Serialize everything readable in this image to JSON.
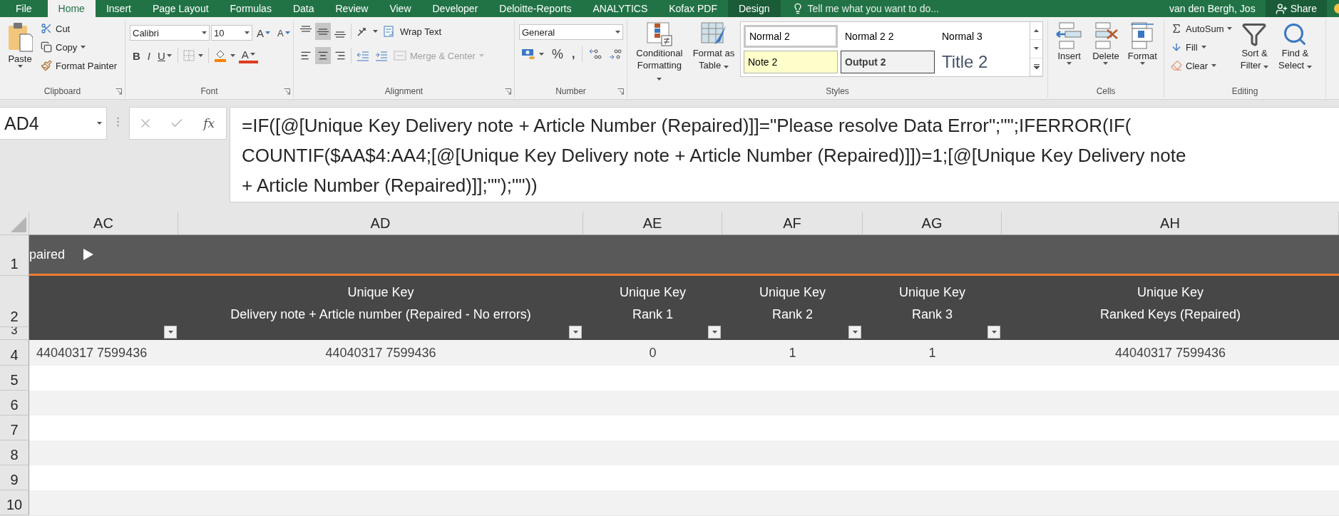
{
  "tabs": [
    {
      "label": "File",
      "kind": "file",
      "selected": false
    },
    {
      "label": "Home",
      "kind": "main",
      "selected": true
    },
    {
      "label": "Insert",
      "kind": "main",
      "selected": false
    },
    {
      "label": "Page Layout",
      "kind": "main",
      "selected": false
    },
    {
      "label": "Formulas",
      "kind": "main",
      "selected": false
    },
    {
      "label": "Data",
      "kind": "main",
      "selected": false
    },
    {
      "label": "Review",
      "kind": "main",
      "selected": false
    },
    {
      "label": "View",
      "kind": "main",
      "selected": false
    },
    {
      "label": "Developer",
      "kind": "main",
      "selected": false
    },
    {
      "label": "Deloitte-Reports",
      "kind": "main",
      "selected": false
    },
    {
      "label": "ANALYTICS",
      "kind": "main",
      "selected": false
    },
    {
      "label": "Kofax PDF",
      "kind": "main",
      "selected": false
    },
    {
      "label": "Design",
      "kind": "contextual",
      "selected": false
    }
  ],
  "tell_me": "Tell me what you want to do...",
  "user": "van den Bergh, Jos",
  "share": "Share",
  "clipboard": {
    "label": "Clipboard",
    "paste": "Paste",
    "cut": "Cut",
    "copy": "Copy",
    "format_painter": "Format Painter"
  },
  "font": {
    "label": "Font",
    "font_name": "Calibri",
    "font_size": "10",
    "grow": "A",
    "shrink": "A",
    "bold": "B",
    "italic": "I",
    "underline": "U",
    "font_color": "A"
  },
  "alignment": {
    "label": "Alignment",
    "align_buttons": [
      {
        "kind": "top",
        "selected": false
      },
      {
        "kind": "middle",
        "selected": true
      },
      {
        "kind": "bottom",
        "selected": false
      },
      {
        "kind": "left",
        "selected": false
      },
      {
        "kind": "center",
        "selected": true
      },
      {
        "kind": "right",
        "selected": false
      }
    ],
    "wrap_text": "Wrap Text",
    "merge_center": {
      "label": "Merge & Center",
      "disabled": true
    }
  },
  "number": {
    "label": "Number",
    "format": "General",
    "percent": "%",
    "comma": ","
  },
  "styles": {
    "label": "Styles",
    "conditional": "Conditional Formatting",
    "format_table": "Format as Table",
    "gallery": [
      {
        "label": "Normal 2",
        "kind": "normal",
        "selected": true
      },
      {
        "label": "Normal 2 2",
        "kind": "normal",
        "selected": false
      },
      {
        "label": "Normal 3",
        "kind": "normal",
        "selected": false
      },
      {
        "label": "Note 2",
        "kind": "note",
        "selected": false
      },
      {
        "label": "Output 2",
        "kind": "output",
        "selected": false
      },
      {
        "label": "Title 2",
        "kind": "title",
        "selected": false
      }
    ]
  },
  "cells": {
    "label": "Cells",
    "buttons": [
      {
        "label": "Insert",
        "kind": "insert"
      },
      {
        "label": "Delete",
        "kind": "delete"
      },
      {
        "label": "Format",
        "kind": "format"
      }
    ]
  },
  "editing": {
    "label": "Editing",
    "autosum": "AutoSum",
    "fill": "Fill",
    "clear": "Clear",
    "sort": "Sort & Filter",
    "find": "Find & Select"
  },
  "name_box": "AD4",
  "insert_function": "fx",
  "formula": "=IF([@[Unique Key Delivery note + Article Number (Repaired)]]=\"Please resolve Data Error\";\"\";IFERROR(IF(\nCOUNTIF($AA$4:AA4;[@[Unique Key Delivery note + Article Number (Repaired)]])=1;[@[Unique Key Delivery note\n+ Article Number (Repaired)]];\"\");\"\"))",
  "columns": [
    "AC",
    "AD",
    "AE",
    "AF",
    "AG",
    "AH"
  ],
  "table": {
    "title": "paired",
    "headers": [
      {
        "filter_button": true
      },
      {
        "text": "Unique Key\nDelivery note + Article number (Repaired - No errors)",
        "filter_button": true
      },
      {
        "text": "Unique Key\nRank 1",
        "filter_button": true
      },
      {
        "text": "Unique Key\nRank 2",
        "filter_button": true
      },
      {
        "text": "Unique Key\nRank 3",
        "filter_button": true
      },
      {
        "text": "Unique Key\nRanked Keys (Repaired)",
        "filter_button": false
      }
    ],
    "row": [
      "44040317 7599436",
      "44040317 7599436",
      "0",
      "1",
      "1",
      "44040317 7599436"
    ]
  },
  "row_numbers": [
    "1",
    "2",
    "3",
    "4",
    "5",
    "6",
    "7",
    "8",
    "9",
    "10"
  ]
}
